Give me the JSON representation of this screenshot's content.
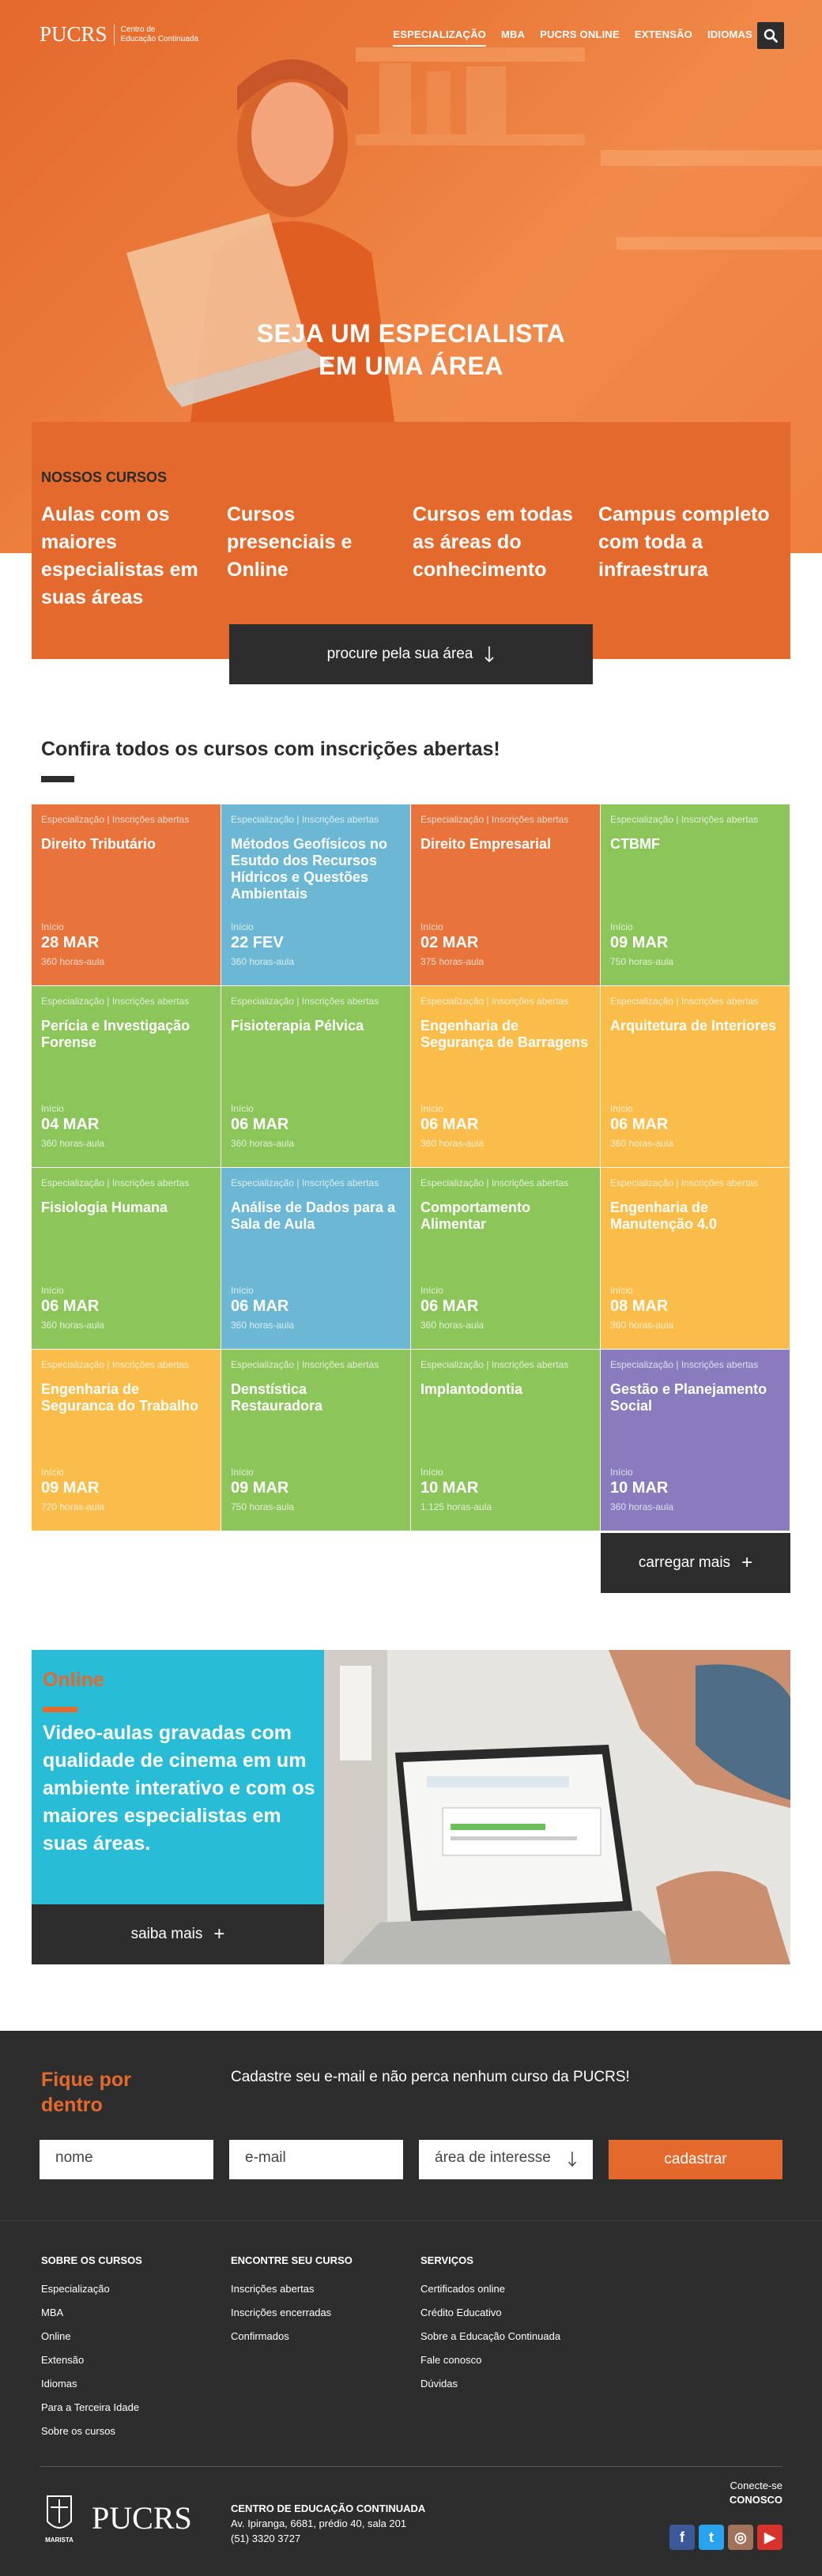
{
  "header": {
    "logo_word": "PUCRS",
    "logo_sub_line1": "Centro de",
    "logo_sub_line2": "Educação Continuada",
    "nav": [
      "ESPECIALIZAÇÃO",
      "MBA",
      "PUCRS ONLINE",
      "EXTENSÃO",
      "IDIOMAS"
    ],
    "search_icon": "search-icon"
  },
  "hero": {
    "title_line1": "SEJA UM ESPECIALISTA",
    "title_line2": "EM UMA ÁREA"
  },
  "courses_panel": {
    "heading": "NOSSOS CURSOS",
    "columns": [
      "Aulas com os maiores especialistas em suas áreas",
      "Cursos presenciais e Online",
      "Cursos em todas as áreas do conhecimento",
      "Campus completo com toda a infraestrura"
    ],
    "area_button": "procure pela sua área",
    "area_button_icon": "arrow-down-icon"
  },
  "open_courses": {
    "title": "Confira todos os cursos com inscrições abertas!",
    "cards": [
      {
        "meta": "Especialização | Inscrições abertas",
        "title": "Direito Tributário",
        "start_label": "Início",
        "date": "28 MAR",
        "hours": "360 horas-aula",
        "color": "#e8733b"
      },
      {
        "meta": "Especialização | Inscrições abertas",
        "title": "Métodos Geofísicos no Esutdo dos Recursos Hídricos e Questões Ambientais",
        "start_label": "Início",
        "date": "22 FEV",
        "hours": "360 horas-aula",
        "color": "#6cb8d4"
      },
      {
        "meta": "Especialização | Inscrições abertas",
        "title": "Direito Empresarial",
        "start_label": "Início",
        "date": "02 MAR",
        "hours": "375 horas-aula",
        "color": "#e8733b"
      },
      {
        "meta": "Especialização | Inscrições abertas",
        "title": "CTBMF",
        "start_label": "Início",
        "date": "09 MAR",
        "hours": "750 horas-aula",
        "color": "#8cc65a"
      },
      {
        "meta": "Especialização | Inscrições abertas",
        "title": "Perícia e Investigação Forense",
        "start_label": "Início",
        "date": "04 MAR",
        "hours": "360 horas-aula",
        "color": "#8cc65a"
      },
      {
        "meta": "Especialização | Inscrições abertas",
        "title": "Fisioterapia Pélvica",
        "start_label": "Início",
        "date": "06 MAR",
        "hours": "360 horas-aula",
        "color": "#8cc65a"
      },
      {
        "meta": "Especialização | Inscrições abertas",
        "title": "Engenharia de Segurança de Barragens",
        "start_label": "Início",
        "date": "06 MAR",
        "hours": "360 horas-aula",
        "color": "#fbbd4a"
      },
      {
        "meta": "Especialização | Inscrições abertas",
        "title": "Arquitetura de Interiores",
        "start_label": "Início",
        "date": "06 MAR",
        "hours": "360 horas-aula",
        "color": "#fbbd4a"
      },
      {
        "meta": "Especialização | Inscrições abertas",
        "title": "Fisiologia Humana",
        "start_label": "Início",
        "date": "06 MAR",
        "hours": "360 horas-aula",
        "color": "#8cc65a"
      },
      {
        "meta": "Especialização | Inscrições abertas",
        "title": "Análise de Dados para a Sala de Aula",
        "start_label": "Início",
        "date": "06 MAR",
        "hours": "360 horas-aula",
        "color": "#6cb8d4"
      },
      {
        "meta": "Especialização | Inscrições abertas",
        "title": "Comportamento Alimentar",
        "start_label": "Início",
        "date": "06 MAR",
        "hours": "360 horas-aula",
        "color": "#8cc65a"
      },
      {
        "meta": "Especialização | Inscrições abertas",
        "title": "Engenharia de Manutenção 4.0",
        "start_label": "Início",
        "date": "08 MAR",
        "hours": "360 horas-aula",
        "color": "#fbbd4a"
      },
      {
        "meta": "Especialização | Inscrições abertas",
        "title": "Engenharia de Seguranca do Trabalho",
        "start_label": "Início",
        "date": "09 MAR",
        "hours": "720 horas-aula",
        "color": "#fbbd4a"
      },
      {
        "meta": "Especialização | Inscrições abertas",
        "title": "Denstística Restauradora",
        "start_label": "Início",
        "date": "09 MAR",
        "hours": "750 horas-aula",
        "color": "#8cc65a"
      },
      {
        "meta": "Especialização | Inscrições abertas",
        "title": "Implantodontia",
        "start_label": "Início",
        "date": "10 MAR",
        "hours": "1.125 horas-aula",
        "color": "#8cc65a"
      },
      {
        "meta": "Especialização | Inscrições abertas",
        "title": "Gestão e Planejamento Social",
        "start_label": "Início",
        "date": "10 MAR",
        "hours": "360 horas-aula",
        "color": "#8a7bbf"
      }
    ],
    "load_more": "carregar mais",
    "load_more_icon": "plus-icon"
  },
  "online": {
    "label": "Online",
    "text": "Video-aulas gravadas com qualidade de cinema em um ambiente interativo e com os maiores especialistas em suas áreas.",
    "button": "saiba mais",
    "button_icon": "plus-icon"
  },
  "newsletter": {
    "title_line1": "Fique por",
    "title_line2": "dentro",
    "text": "Cadastre seu e-mail e não perca nenhum curso da PUCRS!",
    "name_placeholder": "nome",
    "email_placeholder": "e-mail",
    "interest_select": "área de interesse",
    "submit": "cadastrar"
  },
  "footer": {
    "columns": [
      {
        "title": "SOBRE OS CURSOS",
        "links": [
          "Especialização",
          "MBA",
          "Online",
          "Extensão",
          "Idiomas",
          "Para a Terceira Idade",
          "Sobre os cursos"
        ]
      },
      {
        "title": "ENCONTRE SEU CURSO",
        "links": [
          "Inscrições abertas",
          "Inscrições encerradas",
          "Confirmados"
        ]
      },
      {
        "title": "SERVIÇOS",
        "links": [
          "Certificados online",
          "Crédito Educativo",
          "Sobre a Educação Continuada",
          "Fale conosco",
          "Dúvidas"
        ]
      }
    ],
    "crest_label": "MARISTA",
    "brand": "PUCRS",
    "address_title": "CENTRO DE EDUCAÇÃO CONTINUADA",
    "address_line1": "Av. Ipiranga, 6681, prédio 40, sala 201",
    "address_line2": "(51) 3320 3727",
    "connect_line1": "Conecte-se",
    "connect_line2": "CONOSCO",
    "social": [
      {
        "icon": "facebook-icon",
        "glyph": "f",
        "color": "#3b5998"
      },
      {
        "icon": "twitter-icon",
        "glyph": "t",
        "color": "#2aa3ef"
      },
      {
        "icon": "instagram-icon",
        "glyph": "◎",
        "color": "#a0735a"
      },
      {
        "icon": "youtube-icon",
        "glyph": "▶",
        "color": "#d8332b"
      }
    ]
  }
}
